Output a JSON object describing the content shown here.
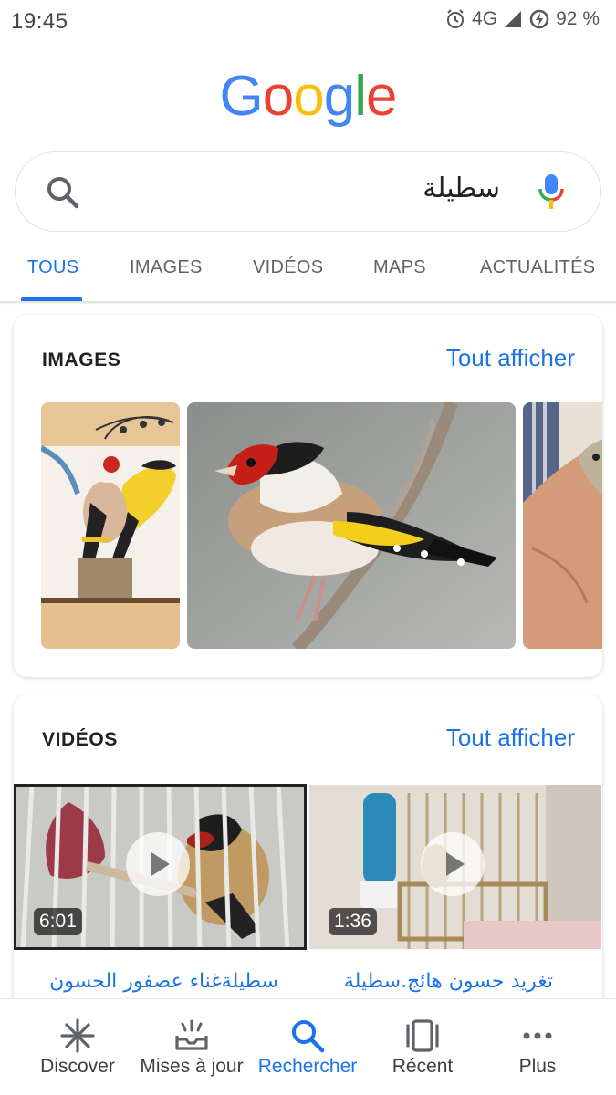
{
  "status_bar": {
    "time": "19:45",
    "network": "4G",
    "battery": "92 %"
  },
  "logo": {
    "letters": [
      "G",
      "o",
      "o",
      "g",
      "l",
      "e"
    ],
    "colors": [
      "#4285F4",
      "#EA4335",
      "#FBBC05",
      "#4285F4",
      "#34A853",
      "#EA4335"
    ]
  },
  "search": {
    "query": "سطيلة"
  },
  "tabs": [
    {
      "label": "TOUS",
      "active": true
    },
    {
      "label": "IMAGES",
      "active": false
    },
    {
      "label": "VIDÉOS",
      "active": false
    },
    {
      "label": "MAPS",
      "active": false
    },
    {
      "label": "ACTUALITÉS",
      "active": false
    }
  ],
  "images_section": {
    "title": "IMAGES",
    "link": "Tout afficher"
  },
  "videos_section": {
    "title": "VIDÉOS",
    "link": "Tout afficher",
    "items": [
      {
        "duration": "6:01",
        "title": "سطيلةغناء عصفور الحسون"
      },
      {
        "duration": "1:36",
        "title": "تغريد حسون هائج.سطيلة"
      }
    ]
  },
  "bottom_nav": [
    {
      "label": "Discover",
      "icon": "asterisk-icon",
      "active": false
    },
    {
      "label": "Mises à jour",
      "icon": "updates-tray-icon",
      "active": false
    },
    {
      "label": "Rechercher",
      "icon": "search-icon",
      "active": true
    },
    {
      "label": "Récent",
      "icon": "recent-cards-icon",
      "active": false
    },
    {
      "label": "Plus",
      "icon": "more-dots-icon",
      "active": false
    }
  ],
  "colors": {
    "accent": "#1a73e8",
    "text": "#202124",
    "secondary_text": "#5f6368"
  }
}
